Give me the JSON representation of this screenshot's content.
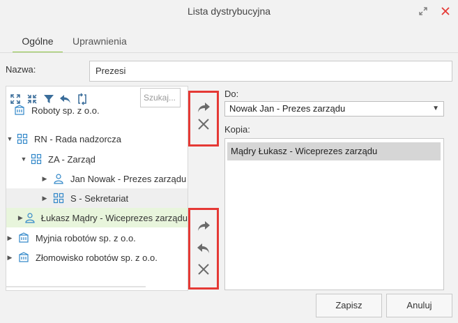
{
  "window": {
    "title": "Lista dystrybucyjna",
    "maximize_icon": "maximize-icon",
    "close_icon": "close-icon",
    "close_color": "#e53935"
  },
  "tabs": [
    {
      "label": "Ogólne",
      "active": true
    },
    {
      "label": "Uprawnienia",
      "active": false
    }
  ],
  "name_field": {
    "label": "Nazwa:",
    "value": "Prezesi"
  },
  "tree_toolbar": {
    "tools": [
      "expand-all-icon",
      "collapse-all-icon",
      "filter-icon",
      "undo-icon",
      "refresh-icon"
    ],
    "search_placeholder": "Szukaj..."
  },
  "tree": [
    {
      "label": "Roboty sp. z o.o.",
      "icon": "company-icon",
      "level": 0,
      "arrow": "",
      "state": ""
    },
    {
      "label": "RN - Rada nadzorcza",
      "icon": "org-unit-icon",
      "level": 0,
      "arrow": "expanded",
      "state": ""
    },
    {
      "label": "ZA - Zarząd",
      "icon": "org-unit-icon",
      "level": 1,
      "arrow": "expanded",
      "state": ""
    },
    {
      "label": "Jan Nowak - Prezes zarządu",
      "icon": "person-icon",
      "level": 2,
      "arrow": "collapsed",
      "state": ""
    },
    {
      "label": "S - Sekretariat",
      "icon": "org-unit-icon",
      "level": 2,
      "arrow": "collapsed",
      "state": "hover"
    },
    {
      "label": "Łukasz Mądry - Wiceprezes zarządu",
      "icon": "person-icon",
      "level": 2,
      "arrow": "collapsed",
      "state": "selected"
    },
    {
      "label": "Myjnia robotów sp. z o.o.",
      "icon": "company-icon",
      "level": 0,
      "arrow": "collapsed",
      "state": ""
    },
    {
      "label": "Złomowisko robotów sp. z o.o.",
      "icon": "company-icon",
      "level": 0,
      "arrow": "collapsed",
      "state": ""
    }
  ],
  "actions": {
    "to_group": [
      "forward-icon",
      "remove-icon"
    ],
    "copy_group": [
      "forward-icon",
      "back-icon",
      "remove-icon"
    ],
    "highlight_color": "#e53935"
  },
  "to": {
    "label": "Do:",
    "selected": "Nowak Jan - Prezes zarządu"
  },
  "copy": {
    "label": "Kopia:",
    "items": [
      "Mądry Łukasz - Wiceprezes zarządu"
    ]
  },
  "buttons": {
    "save": "Zapisz",
    "cancel": "Anuluj"
  },
  "colors": {
    "accent": "#8cc63f",
    "icon_blue": "#2f86c8",
    "selected_row": "#e8f5dc"
  }
}
